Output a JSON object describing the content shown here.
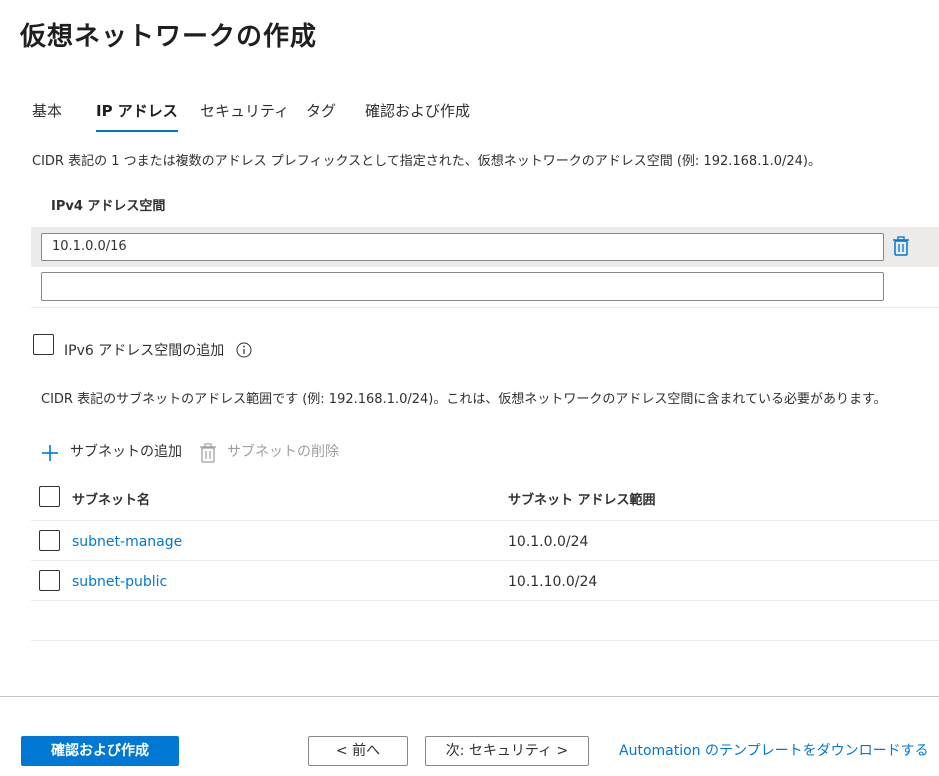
{
  "page": {
    "title": "仮想ネットワークの作成"
  },
  "tabs": [
    {
      "label": "基本",
      "active": false
    },
    {
      "label": "IP アドレス",
      "active": true
    },
    {
      "label": "セキュリティ",
      "active": false
    },
    {
      "label": "タグ",
      "active": false
    },
    {
      "label": "確認および作成",
      "active": false
    }
  ],
  "ipv4": {
    "description": "CIDR 表記の 1 つまたは複数のアドレス プレフィックスとして指定された、仮想ネットワークのアドレス空間 (例: 192.168.1.0/24)。",
    "label": "IPv4 アドレス空間",
    "entries": [
      {
        "value": "10.1.0.0/16"
      },
      {
        "value": ""
      }
    ]
  },
  "ipv6": {
    "checkbox_label": "IPv6 アドレス空間の追加",
    "checked": false
  },
  "subnets": {
    "description": "CIDR 表記のサブネットのアドレス範囲です (例: 192.168.1.0/24)。これは、仮想ネットワークのアドレス空間に含まれている必要があります。",
    "add_label": "サブネットの追加",
    "delete_label": "サブネットの削除",
    "columns": {
      "name": "サブネット名",
      "range": "サブネット アドレス範囲"
    },
    "rows": [
      {
        "name": "subnet-manage",
        "range": "10.1.0.0/24"
      },
      {
        "name": "subnet-public",
        "range": "10.1.10.0/24"
      }
    ]
  },
  "footer": {
    "review_create_label": "確認および作成",
    "prev_label": "< 前へ",
    "next_label": "次: セキュリティ >",
    "download_label": "Automation のテンプレートをダウンロードする"
  },
  "colors": {
    "accent": "#0078d4",
    "text": "#323130",
    "selected_row": "#edebe9"
  },
  "icons": [
    "delete-icon",
    "info-icon",
    "add-icon",
    "trash-icon",
    "checkbox"
  ]
}
